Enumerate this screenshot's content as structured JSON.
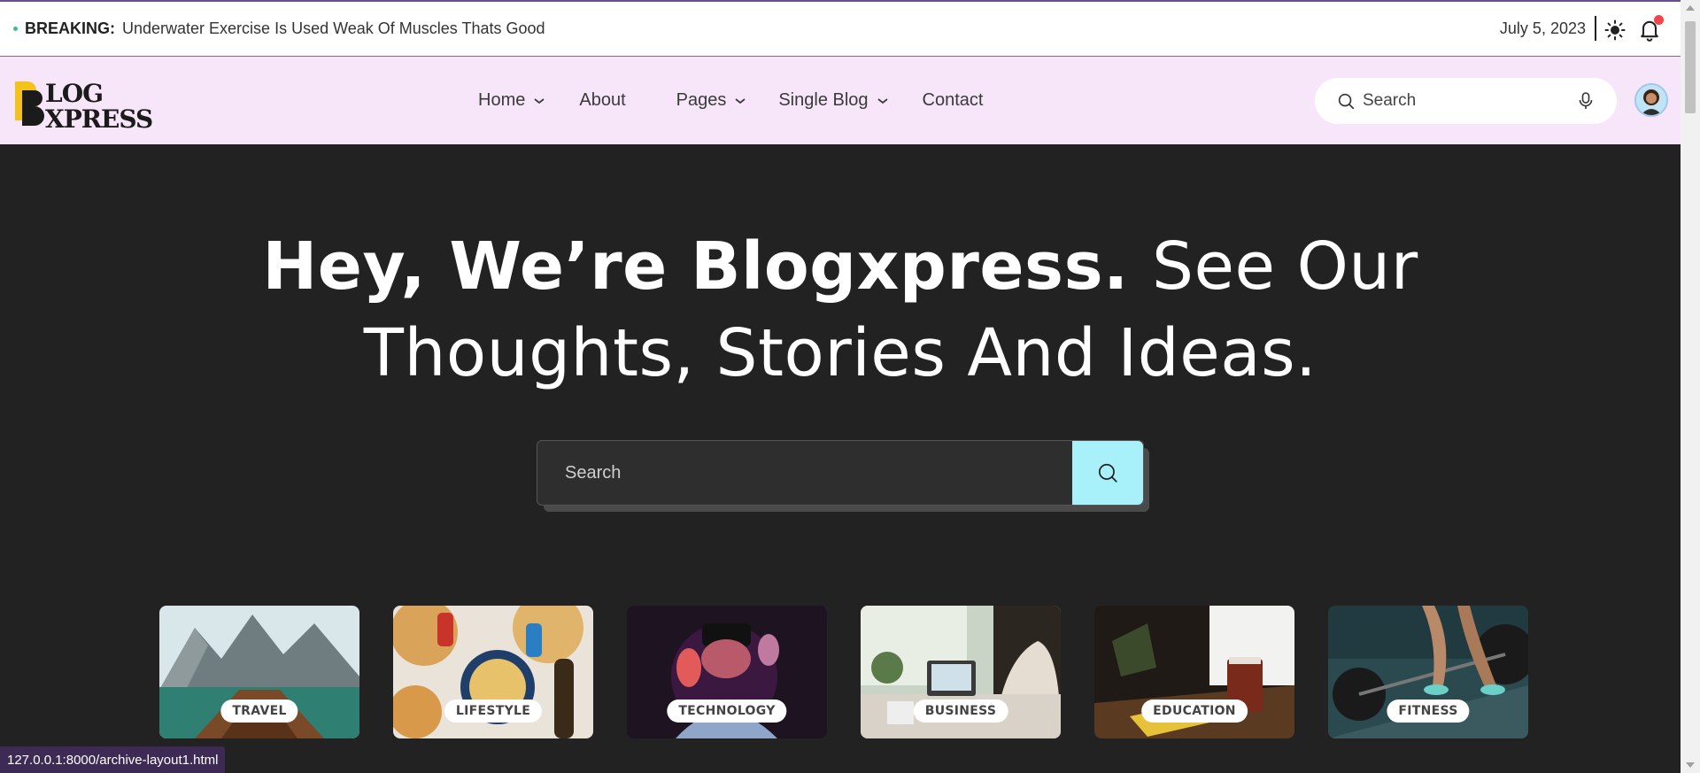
{
  "topbar": {
    "breaking_label": "BREAKING:",
    "headline": "Underwater Exercise Is Used Weak Of Muscles Thats Good",
    "date": "July 5, 2023",
    "theme_icon": "sun-icon",
    "notification_icon": "bell-icon"
  },
  "header": {
    "logo_alt": "BLOG XPRESS",
    "nav": [
      {
        "label": "Home",
        "has_dropdown": true
      },
      {
        "label": "About",
        "has_dropdown": false
      },
      {
        "label": "Pages",
        "has_dropdown": true
      },
      {
        "label": "Single Blog",
        "has_dropdown": true
      },
      {
        "label": "Contact",
        "has_dropdown": false
      }
    ],
    "search_placeholder": "Search"
  },
  "hero": {
    "title_bold": "Hey, We’re Blogxpress.",
    "title_light_1": "See Our",
    "title_light_2": "Thoughts, Stories And Ideas.",
    "search_placeholder": "Search"
  },
  "categories": [
    {
      "label": "TRAVEL"
    },
    {
      "label": "LIFESTYLE"
    },
    {
      "label": "TECHNOLOGY"
    },
    {
      "label": "BUSINESS"
    },
    {
      "label": "EDUCATION"
    },
    {
      "label": "FITNESS"
    }
  ],
  "statusbar": {
    "url": "127.0.0.1:8000/archive-layout1.html"
  },
  "colors": {
    "header_bg": "#f7e6f9",
    "hero_bg": "#222222",
    "accent_button": "#a9f1fa",
    "breaking_dot": "#34c38f",
    "notification_dot": "#f0454b"
  }
}
